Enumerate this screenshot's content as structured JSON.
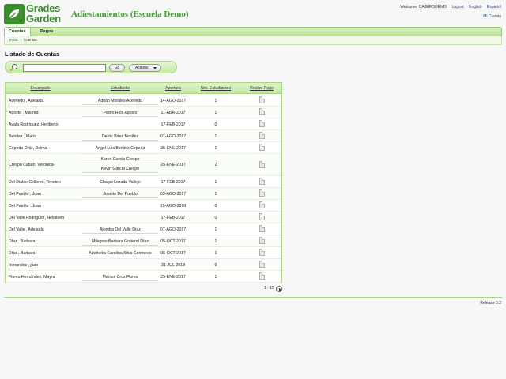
{
  "brand": {
    "logo_line1": "Grades",
    "logo_line2": "Garden",
    "app_title": "Adiestamientos (Escuela Demo)"
  },
  "top_links": {
    "welcome": "Welcome: CAJERODEMO",
    "logout": "Logout",
    "english": "English",
    "espanol": "Español",
    "mi_cuenta": "Mi Cuenta"
  },
  "nav": {
    "tabs": [
      {
        "label": "Cuentas",
        "active": true
      },
      {
        "label": "Pagos",
        "active": false
      }
    ]
  },
  "breadcrumb": {
    "items": [
      "Inicio",
      "Cuentas"
    ],
    "separator": "›"
  },
  "page": {
    "title": "Listado de Cuentas"
  },
  "search": {
    "value": "",
    "go_label": "Go",
    "actions_label": "Actions"
  },
  "table": {
    "headers": [
      "Encargado",
      "Estudiante",
      "Apertura",
      "Nro. Estudiantes",
      "Recibo Pago"
    ],
    "rows": [
      {
        "encargado": "Acevedo , Adelaida",
        "estudiantes": [
          "Adrián Morales Acevedo"
        ],
        "apertura": "14-AGO-2017",
        "nro": "1"
      },
      {
        "encargado": "Agosto , Mildred",
        "estudiantes": [
          "Pedro Rios Agosto"
        ],
        "apertura": "11-ABR-2017",
        "nro": "1"
      },
      {
        "encargado": "Ayala Rodríguez, Heriberto",
        "estudiantes": [],
        "apertura": "17-FEB-2017",
        "nro": "0"
      },
      {
        "encargado": "Benítez , María",
        "estudiantes": [
          "Derrik Báez Benítez"
        ],
        "apertura": "07-AGO-2017",
        "nro": "1"
      },
      {
        "encargado": "Cepeda Ortiz, Delma",
        "estudiantes": [
          "Angel Luis Benitez Cepeda"
        ],
        "apertura": "25-ENE-2017",
        "nro": "1"
      },
      {
        "encargado": "Crespo Caban, Veronica-",
        "estudiantes": [
          "Karen García Crespo",
          "Kevin García Crespo"
        ],
        "apertura": "25-ENE-2017",
        "nro": "2"
      },
      {
        "encargado": "Del Diablo Colloreс, Timoteo",
        "estudiantes": [
          "Chagui Lozada Vallejo"
        ],
        "apertura": "17-FEB-2017",
        "nro": "1"
      },
      {
        "encargado": "Del Pueblo , Juan",
        "estudiantes": [
          "Juanito Del Pueblo"
        ],
        "apertura": "03-AGO-2017",
        "nro": "1"
      },
      {
        "encargado": "Del Pueblo , Juan",
        "estudiantes": [],
        "apertura": "15-AGO-2018",
        "nro": "0"
      },
      {
        "encargado": "Del Valle Rodriguez, Heidibeth",
        "estudiantes": [],
        "apertura": "17-FEB-2017",
        "nro": "0"
      },
      {
        "encargado": "Del Valle , Adelaida",
        "estudiantes": [
          "Alondra Del Valle Díaz"
        ],
        "apertura": "07-AGO-2017",
        "nro": "1"
      },
      {
        "encargado": "Díaz , Barbara",
        "estudiantes": [
          "Milagros Barbara Graterol Díaz"
        ],
        "apertura": "05-OCT-2017",
        "nro": "1"
      },
      {
        "encargado": "Díaz , Barbara",
        "estudiantes": [
          "Adarleika Carolina Silva Contreras"
        ],
        "apertura": "05-OCT-2017",
        "nro": "1"
      },
      {
        "encargado": "fernandez , juan",
        "estudiantes": [],
        "apertura": "31-JUL-2018",
        "nro": "0"
      },
      {
        "encargado": "Flores Hernández, Mayra",
        "estudiantes": [
          "Marisol Cruz Flores"
        ],
        "apertura": "25-ENE-2017",
        "nro": "1"
      }
    ]
  },
  "pager": {
    "range": "1 - 15"
  },
  "footer": {
    "release": "Release 3.2"
  }
}
